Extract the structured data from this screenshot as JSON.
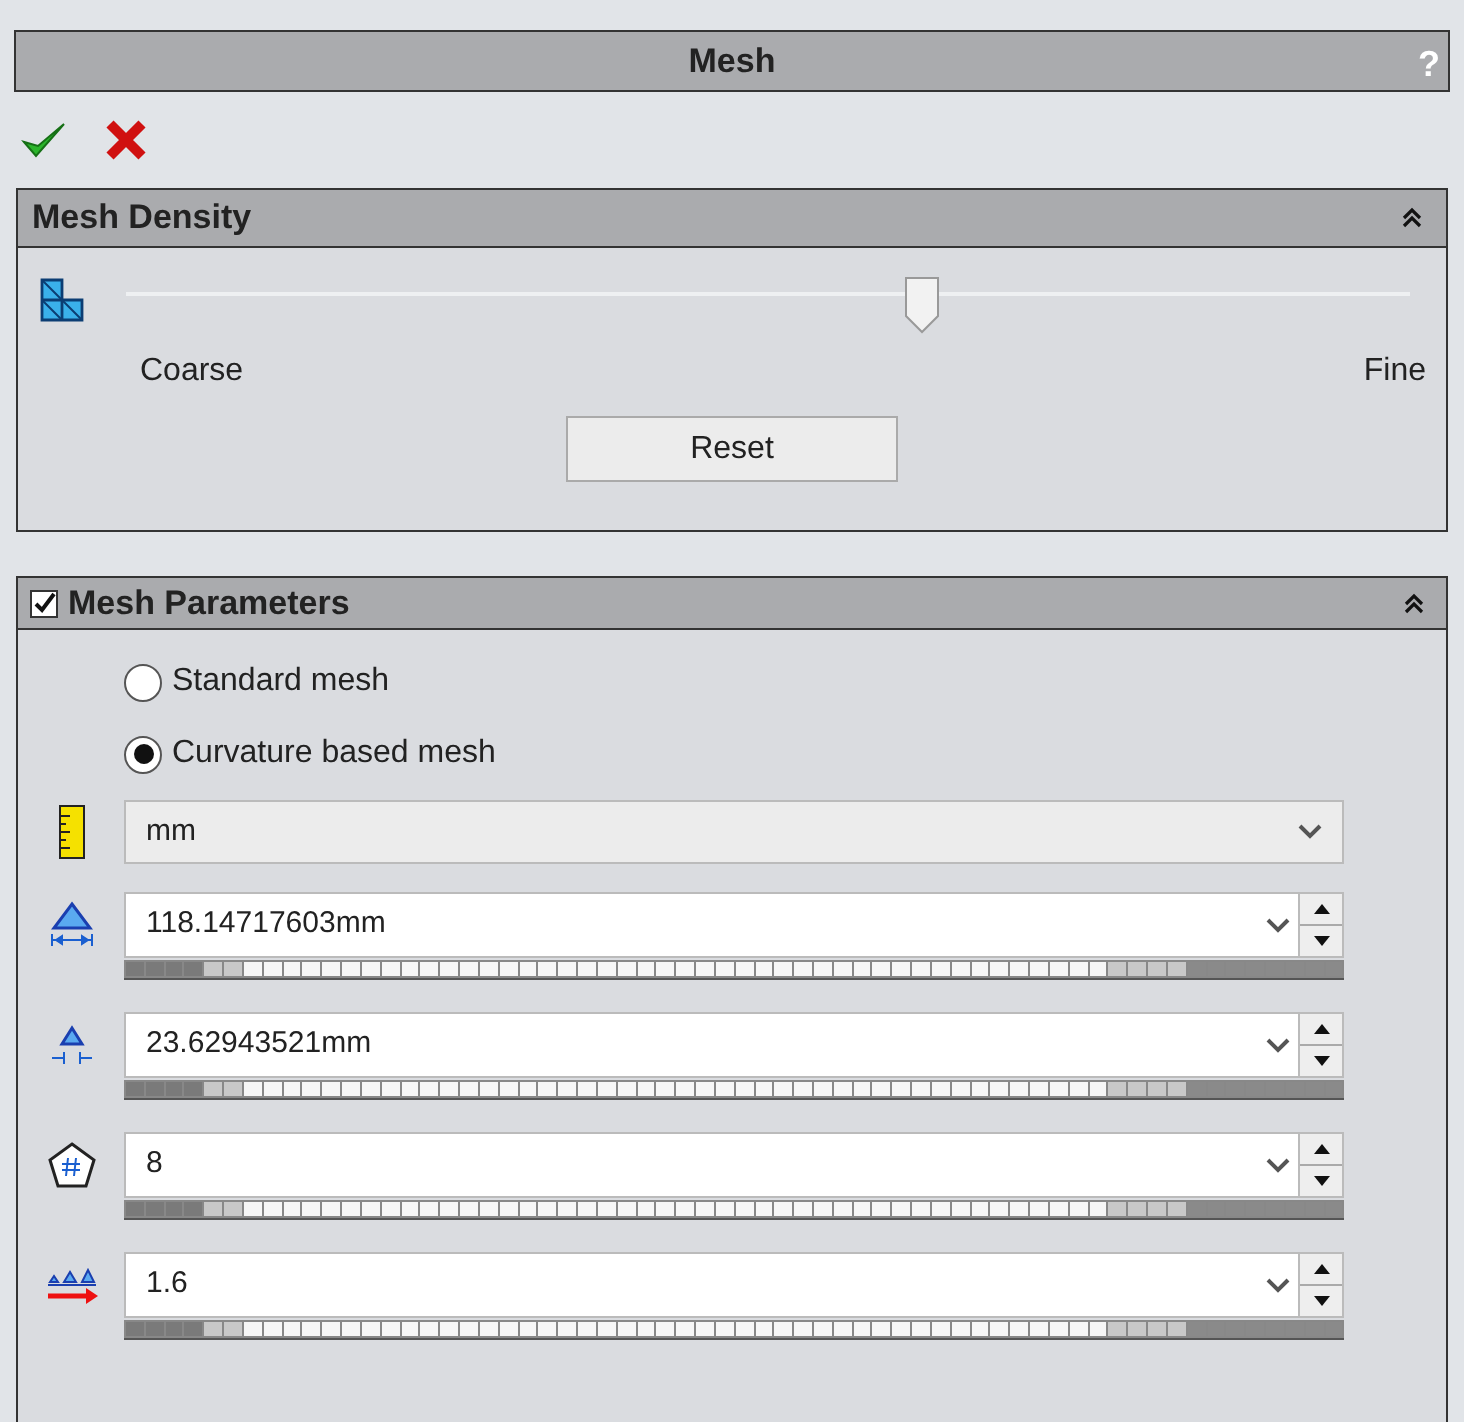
{
  "window": {
    "title": "Mesh",
    "help": "?"
  },
  "mesh_density": {
    "title": "Mesh Density",
    "slider": {
      "level": 0.62
    },
    "min_label": "Coarse",
    "max_label": "Fine",
    "reset_button": "Reset"
  },
  "mesh_parameters": {
    "title": "Mesh Parameters",
    "checked": true,
    "options": [
      {
        "label": "Standard mesh",
        "selected": false
      },
      {
        "label": "Curvature based mesh",
        "selected": true
      }
    ],
    "fields": [
      {
        "kind": "dropdown",
        "value": "mm"
      },
      {
        "kind": "spin",
        "value": "118.14717603mm"
      },
      {
        "kind": "spin",
        "value": "23.62943521mm"
      },
      {
        "kind": "spin",
        "value": "8"
      },
      {
        "kind": "spin",
        "value": "1.6"
      }
    ]
  }
}
